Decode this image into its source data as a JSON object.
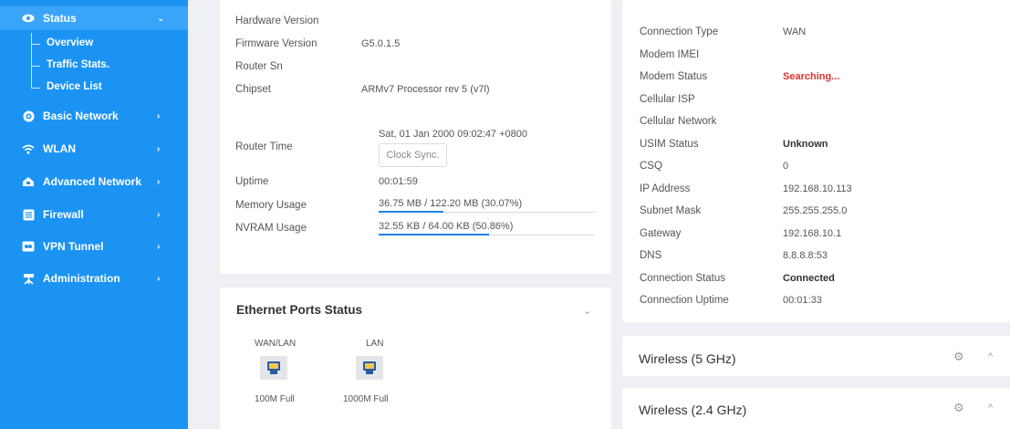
{
  "sidebar": {
    "items": [
      {
        "label": "Status",
        "icon": "eye-icon",
        "chevron": "⌄"
      },
      {
        "label": "Basic Network",
        "icon": "globe-icon",
        "chevron": "›"
      },
      {
        "label": "WLAN",
        "icon": "wifi-icon",
        "chevron": "›"
      },
      {
        "label": "Advanced Network",
        "icon": "router-icon",
        "chevron": "›"
      },
      {
        "label": "Firewall",
        "icon": "firewall-icon",
        "chevron": "›"
      },
      {
        "label": "VPN Tunnel",
        "icon": "vpn-icon",
        "chevron": "›"
      },
      {
        "label": "Administration",
        "icon": "admin-icon",
        "chevron": "›"
      }
    ],
    "status_sub": [
      "Overview",
      "Traffic Stats.",
      "Device List"
    ]
  },
  "router_info": {
    "rows": [
      {
        "label": "Hardware Version",
        "value": ""
      },
      {
        "label": "Firmware Version",
        "value": "G5.0.1.5"
      },
      {
        "label": "Router Sn",
        "value": ""
      },
      {
        "label": "Chipset",
        "value": "ARMv7 Processor rev 5 (v7l)"
      }
    ],
    "router_time_label": "Router Time",
    "router_time_value": "Sat, 01 Jan 2000 09:02:47 +0800",
    "clock_sync_label": "Clock Sync.",
    "uptime_label": "Uptime",
    "uptime_value": "00:01:59",
    "memory_label": "Memory Usage",
    "memory_value": "36.75 MB / 122.20 MB (30.07%)",
    "memory_fraction": 0.3007,
    "nvram_label": "NVRAM Usage",
    "nvram_value": "32.55 KB / 64.00 KB (50.86%)",
    "nvram_fraction": 0.5086
  },
  "ethernet": {
    "title": "Ethernet Ports Status",
    "ports": [
      {
        "name": "WAN/LAN",
        "speed": "100M Full"
      },
      {
        "name": "LAN",
        "speed": "1000M Full"
      }
    ]
  },
  "modem": {
    "rows": [
      {
        "label": "Connection Type",
        "value": "WAN"
      },
      {
        "label": "Modem IMEI",
        "value": ""
      },
      {
        "label": "Modem Status",
        "value": "Searching..."
      },
      {
        "label": "Cellular ISP",
        "value": ""
      },
      {
        "label": "Cellular Network",
        "value": ""
      },
      {
        "label": "USIM Status",
        "value": "Unknown"
      },
      {
        "label": "CSQ",
        "value": "0"
      },
      {
        "label": "IP Address",
        "value": "192.168.10.113"
      },
      {
        "label": "Subnet Mask",
        "value": "255.255.255.0"
      },
      {
        "label": "Gateway",
        "value": "192.168.10.1"
      },
      {
        "label": "DNS",
        "value": "8.8.8.8:53"
      },
      {
        "label": "Connection Status",
        "value": "Connected"
      },
      {
        "label": "Connection Uptime",
        "value": "00:01:33"
      }
    ],
    "status_color": "#e0322c"
  },
  "wireless": [
    {
      "title": "Wireless (5 GHz)"
    },
    {
      "title": "Wireless (2.4 GHz)"
    }
  ],
  "colors": {
    "sidebar": "#1b93f3",
    "accent": "#1b84e6",
    "alert": "#e0322c"
  }
}
